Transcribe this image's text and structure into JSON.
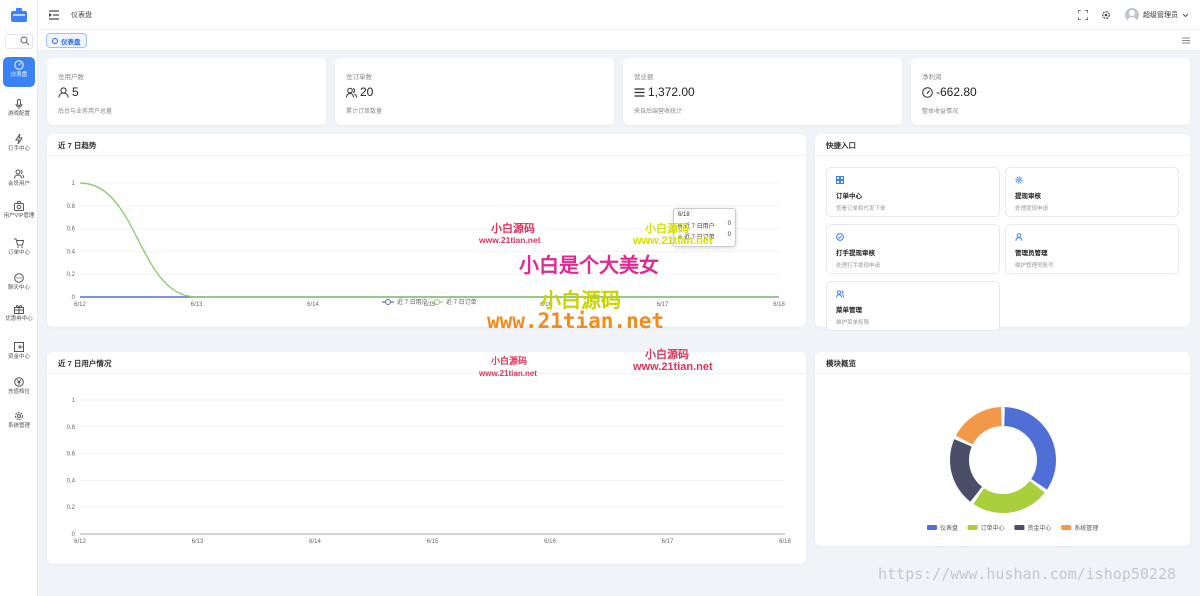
{
  "sidebar": {
    "items": [
      {
        "label": "仪表盘",
        "icon": "dashboard-icon",
        "active": true
      },
      {
        "label": "游戏配置",
        "icon": "mic-icon"
      },
      {
        "label": "打手中心",
        "icon": "lightning-icon"
      },
      {
        "label": "会员用户",
        "icon": "users-icon"
      },
      {
        "label": "用户VIP管理",
        "icon": "camera-icon"
      },
      {
        "label": "订单中心",
        "icon": "cart-icon"
      },
      {
        "label": "聊天中心",
        "icon": "chat-icon"
      },
      {
        "label": "优惠券中心",
        "icon": "gift-icon"
      },
      {
        "label": "资金中心",
        "icon": "wallet-icon"
      },
      {
        "label": "充值档位",
        "icon": "yen-icon"
      },
      {
        "label": "系统管理",
        "icon": "gear-icon"
      }
    ]
  },
  "topbar": {
    "title": "仪表盘",
    "user": "超级管理员"
  },
  "tabs": [
    {
      "label": "仪表盘",
      "active": true
    }
  ],
  "stats": [
    {
      "label": "总用户数",
      "value": "5",
      "sub": "后台与业务用户总量",
      "icon": "user-icon"
    },
    {
      "label": "总订单数",
      "value": "20",
      "sub": "累计订单数量",
      "icon": "users-icon"
    },
    {
      "label": "营业额",
      "value": "1,372.00",
      "sub": "来自后端营收统计",
      "icon": "list-icon"
    },
    {
      "label": "净利润",
      "value": "-662.80",
      "sub": "整体收益情况",
      "icon": "gauge-icon"
    }
  ],
  "trend": {
    "title": "近 7 日趋势"
  },
  "users_chart": {
    "title": "近 7 日用户情况"
  },
  "quick": {
    "title": "快捷入口",
    "items": [
      {
        "title": "订单中心",
        "desc": "查看订单和代发下单",
        "icon": "grid-icon"
      },
      {
        "title": "提现审核",
        "desc": "处理提现申请",
        "icon": "gear-icon"
      },
      {
        "title": "打手提现审核",
        "desc": "处理打手提现申请",
        "icon": "check-circle-icon"
      },
      {
        "title": "管理员管理",
        "desc": "维护管理员账号",
        "icon": "user-icon"
      },
      {
        "title": "菜单管理",
        "desc": "维护菜单权限",
        "icon": "users-icon"
      }
    ]
  },
  "modules": {
    "title": "模块概览"
  },
  "chart_data": [
    {
      "type": "line",
      "x": [
        "6/12",
        "6/13",
        "6/14",
        "6/15",
        "6/16",
        "6/17",
        "6/18"
      ],
      "ylim": [
        0,
        1
      ],
      "yticks": [
        "0",
        "0.2",
        "0.4",
        "0.6",
        "0.8",
        "1"
      ],
      "series": [
        {
          "name": "近 7 日用户",
          "values": [
            0,
            0,
            0,
            0,
            0,
            0,
            0
          ],
          "color": "#5470c6"
        },
        {
          "name": "近 7 日订单",
          "values": [
            1,
            0,
            0,
            0,
            0,
            0,
            0
          ],
          "color": "#91cc75"
        }
      ],
      "tooltip": {
        "x": "6/18",
        "rows": [
          {
            "name": "近 7 日用户",
            "value": "0"
          },
          {
            "name": "近 7 日订单",
            "value": "0"
          }
        ]
      }
    },
    {
      "type": "line",
      "x": [
        "6/12",
        "6/13",
        "6/14",
        "6/15",
        "6/16",
        "6/17",
        "6/18"
      ],
      "ylim": [
        0,
        1
      ],
      "yticks": [
        "0",
        "0.2",
        "0.4",
        "0.6",
        "0.8",
        "1"
      ],
      "series": []
    },
    {
      "type": "pie",
      "categories": [
        "仪表盘",
        "订单中心",
        "资金中心",
        "系统管理"
      ],
      "values": [
        35,
        25,
        22,
        18
      ],
      "colors": [
        "#4f6fd6",
        "#a9cf3a",
        "#4a4e68",
        "#f29a4a"
      ],
      "donut": true
    }
  ],
  "watermarks": {
    "small_logo": "小白源码",
    "small_url": "www.21tian.net",
    "slogan": "小白是个大美女",
    "big_logo": "小白源码",
    "big_url": "www.21tian.net",
    "footer": "https://www.hushan.com/ishop50228"
  }
}
